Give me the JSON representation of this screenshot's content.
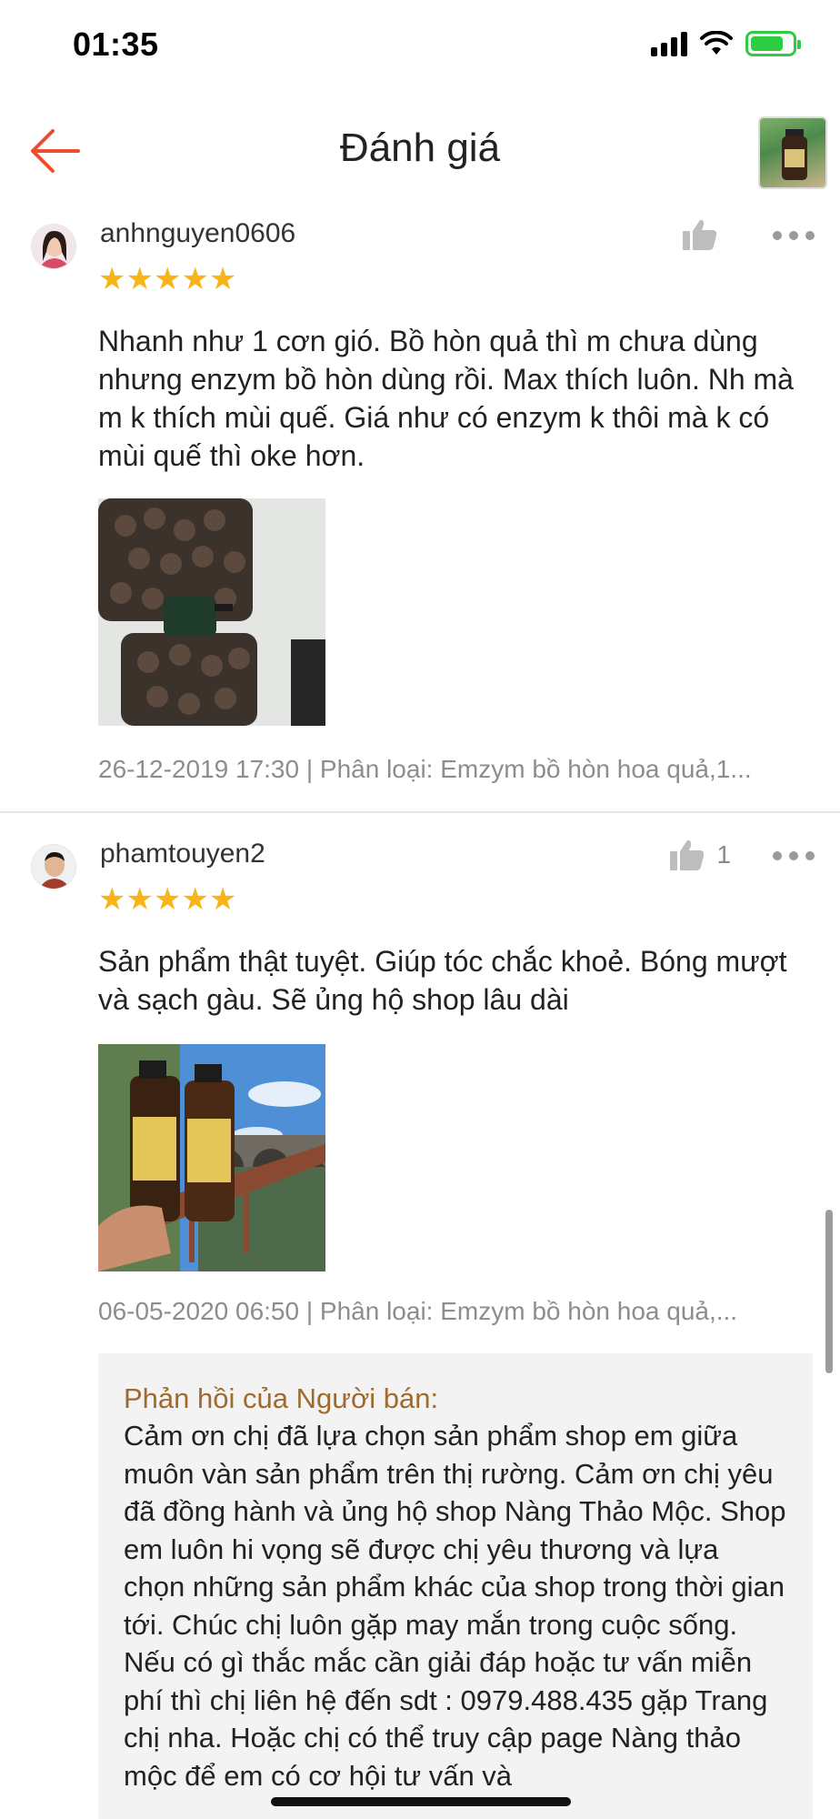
{
  "status_bar": {
    "time": "01:35"
  },
  "header": {
    "title": "Đánh giá"
  },
  "reviews": [
    {
      "username": "anhnguyen0606",
      "stars": "★★★★★",
      "rating": 5,
      "like_count": "",
      "text": "Nhanh như 1 cơn gió. Bồ hòn quả thì m chưa dùng nhưng enzym bồ hòn dùng rồi. Max thích luôn. Nh mà m k thích mùi quế. Giá như có enzym k thôi mà k có mùi quế thì oke hơn.",
      "meta": "26-12-2019 17:30 | Phân loại: Emzym bồ hòn hoa quả,1..."
    },
    {
      "username": "phamtouyen2",
      "stars": "★★★★★",
      "rating": 5,
      "like_count": "1",
      "text": "Sản phẩm thật tuyệt. Giúp tóc chắc khoẻ. Bóng mượt và sạch gàu. Sẽ ủng hộ shop lâu dài",
      "meta": "06-05-2020 06:50 | Phân loại: Emzym bồ hòn hoa quả,...",
      "seller_reply": {
        "title": "Phản hồi của Người bán:",
        "text": "Cảm ơn chị đã lựa chọn sản phẩm shop em giữa muôn vàn sản phẩm trên thị rường. Cảm ơn chị yêu đã đồng hành và ủng hộ shop Nàng Thảo Mộc. Shop em luôn hi vọng sẽ được chị yêu thương và lựa chọn những sản phẩm khác của shop trong thời gian tới. Chúc chị luôn gặp may mắn trong cuộc sống. Nếu có gì thắc mắc cần giải đáp hoặc tư vấn miễn phí thì chị liên hệ đến sdt : 0979.488.435 gặp Trang chị nha. Hoặc chị có thể truy cập page Nàng thảo mộc để em có cơ hội tư vấn và"
      }
    }
  ],
  "colors": {
    "accent": "#ee4d2d",
    "star": "#f7b519",
    "reply_title": "#a06a2c",
    "battery": "#2ecc40"
  },
  "icons": [
    "back-arrow-icon",
    "like-icon",
    "more-icon",
    "signal-icon",
    "wifi-icon",
    "battery-icon"
  ]
}
